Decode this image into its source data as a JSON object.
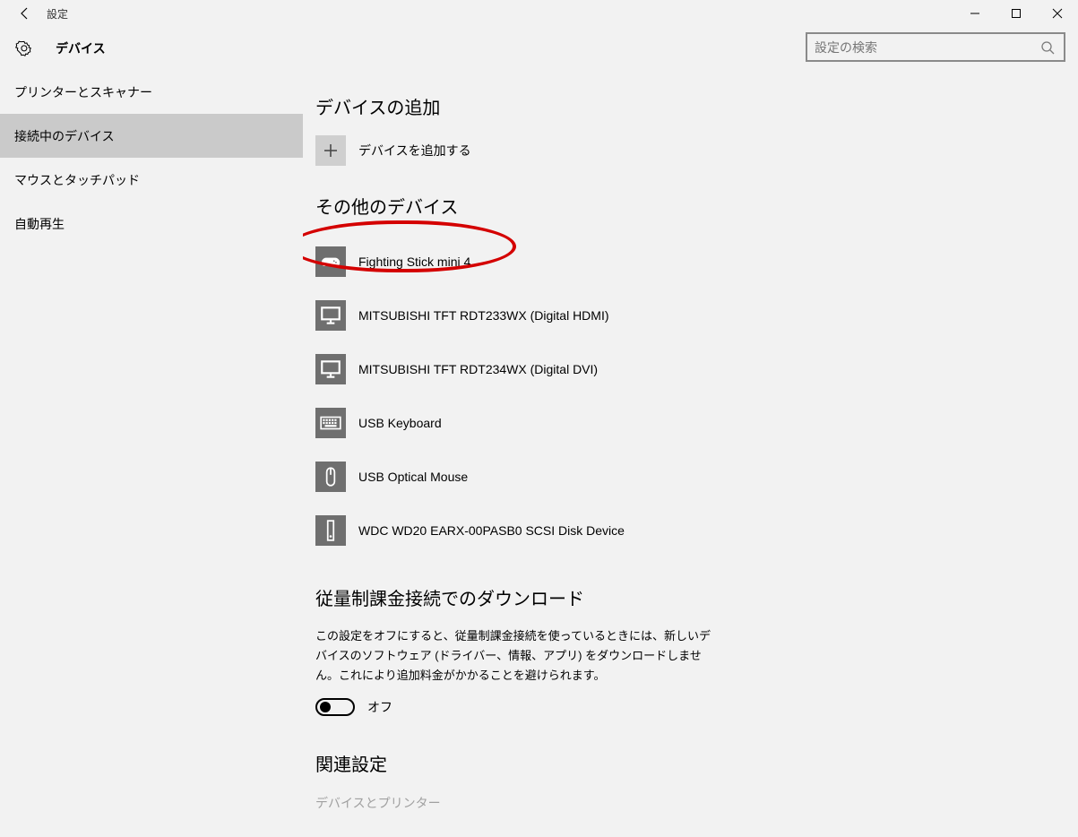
{
  "window": {
    "title": "設定",
    "page_name": "デバイス",
    "search_placeholder": "設定の検索"
  },
  "sidebar": {
    "items": [
      {
        "label": "プリンターとスキャナー",
        "selected": false
      },
      {
        "label": "接続中のデバイス",
        "selected": true
      },
      {
        "label": "マウスとタッチパッド",
        "selected": false
      },
      {
        "label": "自動再生",
        "selected": false
      }
    ]
  },
  "sections": {
    "add": {
      "heading": "デバイスの追加",
      "button_label": "デバイスを追加する"
    },
    "other": {
      "heading": "その他のデバイス",
      "devices": [
        {
          "name": "Fighting Stick mini 4",
          "icon": "gamepad",
          "highlighted": true
        },
        {
          "name": "MITSUBISHI TFT RDT233WX (Digital HDMI)",
          "icon": "monitor"
        },
        {
          "name": "MITSUBISHI TFT RDT234WX (Digital DVI)",
          "icon": "monitor"
        },
        {
          "name": "USB Keyboard",
          "icon": "keyboard"
        },
        {
          "name": "USB Optical Mouse",
          "icon": "mouse"
        },
        {
          "name": "WDC WD20 EARX-00PASB0 SCSI Disk Device",
          "icon": "drive"
        }
      ]
    },
    "metered": {
      "heading": "従量制課金接続でのダウンロード",
      "body": "この設定をオフにすると、従量制課金接続を使っているときには、新しいデバイスのソフトウェア (ドライバー、情報、アプリ) をダウンロードしません。これにより追加料金がかかることを避けられます。",
      "toggle_state": "off",
      "toggle_label": "オフ"
    },
    "related": {
      "heading": "関連設定",
      "links": [
        {
          "label": "デバイスとプリンター"
        }
      ]
    }
  }
}
